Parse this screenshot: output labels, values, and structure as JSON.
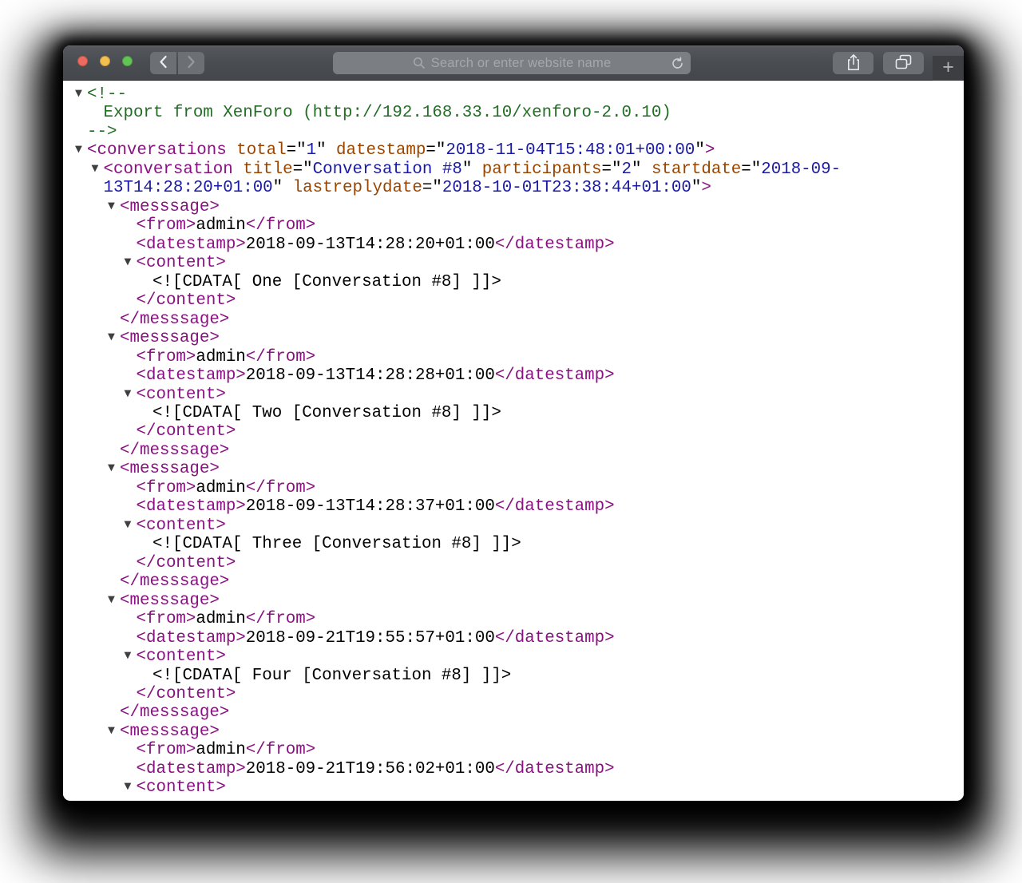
{
  "browser": {
    "search_placeholder": "Search or enter website name",
    "new_tab_label": "+"
  },
  "colors": {
    "tag": "#881280",
    "attr": "#994500",
    "value": "#1a1aa6",
    "comment": "#236e25",
    "text": "#000000",
    "punct": "#000000",
    "arrow": "#3f3f3f"
  },
  "code": {
    "arrow_glyph": "▼",
    "lines": [
      {
        "i": 0,
        "ar": true,
        "s": [
          [
            "comment",
            "<!--"
          ]
        ]
      },
      {
        "i": 1,
        "ar": false,
        "s": [
          [
            "comment",
            "Export from XenForo (http://192.168.33.10/xenforo-2.0.10)"
          ]
        ]
      },
      {
        "i": 0,
        "ar": false,
        "s": [
          [
            "comment",
            "-->"
          ]
        ]
      },
      {
        "i": 0,
        "ar": true,
        "s": [
          [
            "tag",
            "<conversations"
          ],
          [
            "attr",
            " total"
          ],
          [
            "punct",
            "=\""
          ],
          [
            "value",
            "1"
          ],
          [
            "punct",
            "\""
          ],
          [
            "attr",
            " datestamp"
          ],
          [
            "punct",
            "=\""
          ],
          [
            "value",
            "2018-11-04T15:48:01+00:00"
          ],
          [
            "punct",
            "\""
          ],
          [
            "tag",
            ">"
          ]
        ]
      },
      {
        "i": 1,
        "ar": true,
        "s": [
          [
            "tag",
            "<conversation"
          ],
          [
            "attr",
            " title"
          ],
          [
            "punct",
            "=\""
          ],
          [
            "value",
            "Conversation #8"
          ],
          [
            "punct",
            "\""
          ],
          [
            "attr",
            " participants"
          ],
          [
            "punct",
            "=\""
          ],
          [
            "value",
            "2"
          ],
          [
            "punct",
            "\""
          ],
          [
            "attr",
            " startdate"
          ],
          [
            "punct",
            "=\""
          ],
          [
            "value",
            "2018-09-"
          ]
        ]
      },
      {
        "i": 1,
        "ar": false,
        "s": [
          [
            "value",
            "13T14:28:20+01:00"
          ],
          [
            "punct",
            "\""
          ],
          [
            "attr",
            " lastreplydate"
          ],
          [
            "punct",
            "=\""
          ],
          [
            "value",
            "2018-10-01T23:38:44+01:00"
          ],
          [
            "punct",
            "\""
          ],
          [
            "tag",
            ">"
          ]
        ]
      },
      {
        "i": 2,
        "ar": true,
        "s": [
          [
            "tag",
            "<messsage>"
          ]
        ]
      },
      {
        "i": 3,
        "ar": false,
        "s": [
          [
            "tag",
            "<from>"
          ],
          [
            "text",
            "admin"
          ],
          [
            "tag",
            "</from>"
          ]
        ]
      },
      {
        "i": 3,
        "ar": false,
        "s": [
          [
            "tag",
            "<datestamp>"
          ],
          [
            "text",
            "2018-09-13T14:28:20+01:00"
          ],
          [
            "tag",
            "</datestamp>"
          ]
        ]
      },
      {
        "i": 3,
        "ar": true,
        "s": [
          [
            "tag",
            "<content>"
          ]
        ]
      },
      {
        "i": 4,
        "ar": false,
        "s": [
          [
            "text",
            "<![CDATA[ One [Conversation #8] ]]>"
          ]
        ]
      },
      {
        "i": 3,
        "ar": false,
        "s": [
          [
            "tag",
            "</content>"
          ]
        ]
      },
      {
        "i": 2,
        "ar": false,
        "s": [
          [
            "tag",
            "</messsage>"
          ]
        ]
      },
      {
        "i": 2,
        "ar": true,
        "s": [
          [
            "tag",
            "<messsage>"
          ]
        ]
      },
      {
        "i": 3,
        "ar": false,
        "s": [
          [
            "tag",
            "<from>"
          ],
          [
            "text",
            "admin"
          ],
          [
            "tag",
            "</from>"
          ]
        ]
      },
      {
        "i": 3,
        "ar": false,
        "s": [
          [
            "tag",
            "<datestamp>"
          ],
          [
            "text",
            "2018-09-13T14:28:28+01:00"
          ],
          [
            "tag",
            "</datestamp>"
          ]
        ]
      },
      {
        "i": 3,
        "ar": true,
        "s": [
          [
            "tag",
            "<content>"
          ]
        ]
      },
      {
        "i": 4,
        "ar": false,
        "s": [
          [
            "text",
            "<![CDATA[ Two [Conversation #8] ]]>"
          ]
        ]
      },
      {
        "i": 3,
        "ar": false,
        "s": [
          [
            "tag",
            "</content>"
          ]
        ]
      },
      {
        "i": 2,
        "ar": false,
        "s": [
          [
            "tag",
            "</messsage>"
          ]
        ]
      },
      {
        "i": 2,
        "ar": true,
        "s": [
          [
            "tag",
            "<messsage>"
          ]
        ]
      },
      {
        "i": 3,
        "ar": false,
        "s": [
          [
            "tag",
            "<from>"
          ],
          [
            "text",
            "admin"
          ],
          [
            "tag",
            "</from>"
          ]
        ]
      },
      {
        "i": 3,
        "ar": false,
        "s": [
          [
            "tag",
            "<datestamp>"
          ],
          [
            "text",
            "2018-09-13T14:28:37+01:00"
          ],
          [
            "tag",
            "</datestamp>"
          ]
        ]
      },
      {
        "i": 3,
        "ar": true,
        "s": [
          [
            "tag",
            "<content>"
          ]
        ]
      },
      {
        "i": 4,
        "ar": false,
        "s": [
          [
            "text",
            "<![CDATA[ Three [Conversation #8] ]]>"
          ]
        ]
      },
      {
        "i": 3,
        "ar": false,
        "s": [
          [
            "tag",
            "</content>"
          ]
        ]
      },
      {
        "i": 2,
        "ar": false,
        "s": [
          [
            "tag",
            "</messsage>"
          ]
        ]
      },
      {
        "i": 2,
        "ar": true,
        "s": [
          [
            "tag",
            "<messsage>"
          ]
        ]
      },
      {
        "i": 3,
        "ar": false,
        "s": [
          [
            "tag",
            "<from>"
          ],
          [
            "text",
            "admin"
          ],
          [
            "tag",
            "</from>"
          ]
        ]
      },
      {
        "i": 3,
        "ar": false,
        "s": [
          [
            "tag",
            "<datestamp>"
          ],
          [
            "text",
            "2018-09-21T19:55:57+01:00"
          ],
          [
            "tag",
            "</datestamp>"
          ]
        ]
      },
      {
        "i": 3,
        "ar": true,
        "s": [
          [
            "tag",
            "<content>"
          ]
        ]
      },
      {
        "i": 4,
        "ar": false,
        "s": [
          [
            "text",
            "<![CDATA[ Four [Conversation #8] ]]>"
          ]
        ]
      },
      {
        "i": 3,
        "ar": false,
        "s": [
          [
            "tag",
            "</content>"
          ]
        ]
      },
      {
        "i": 2,
        "ar": false,
        "s": [
          [
            "tag",
            "</messsage>"
          ]
        ]
      },
      {
        "i": 2,
        "ar": true,
        "s": [
          [
            "tag",
            "<messsage>"
          ]
        ]
      },
      {
        "i": 3,
        "ar": false,
        "s": [
          [
            "tag",
            "<from>"
          ],
          [
            "text",
            "admin"
          ],
          [
            "tag",
            "</from>"
          ]
        ]
      },
      {
        "i": 3,
        "ar": false,
        "s": [
          [
            "tag",
            "<datestamp>"
          ],
          [
            "text",
            "2018-09-21T19:56:02+01:00"
          ],
          [
            "tag",
            "</datestamp>"
          ]
        ]
      },
      {
        "i": 3,
        "ar": true,
        "s": [
          [
            "tag",
            "<content>"
          ]
        ]
      }
    ]
  }
}
